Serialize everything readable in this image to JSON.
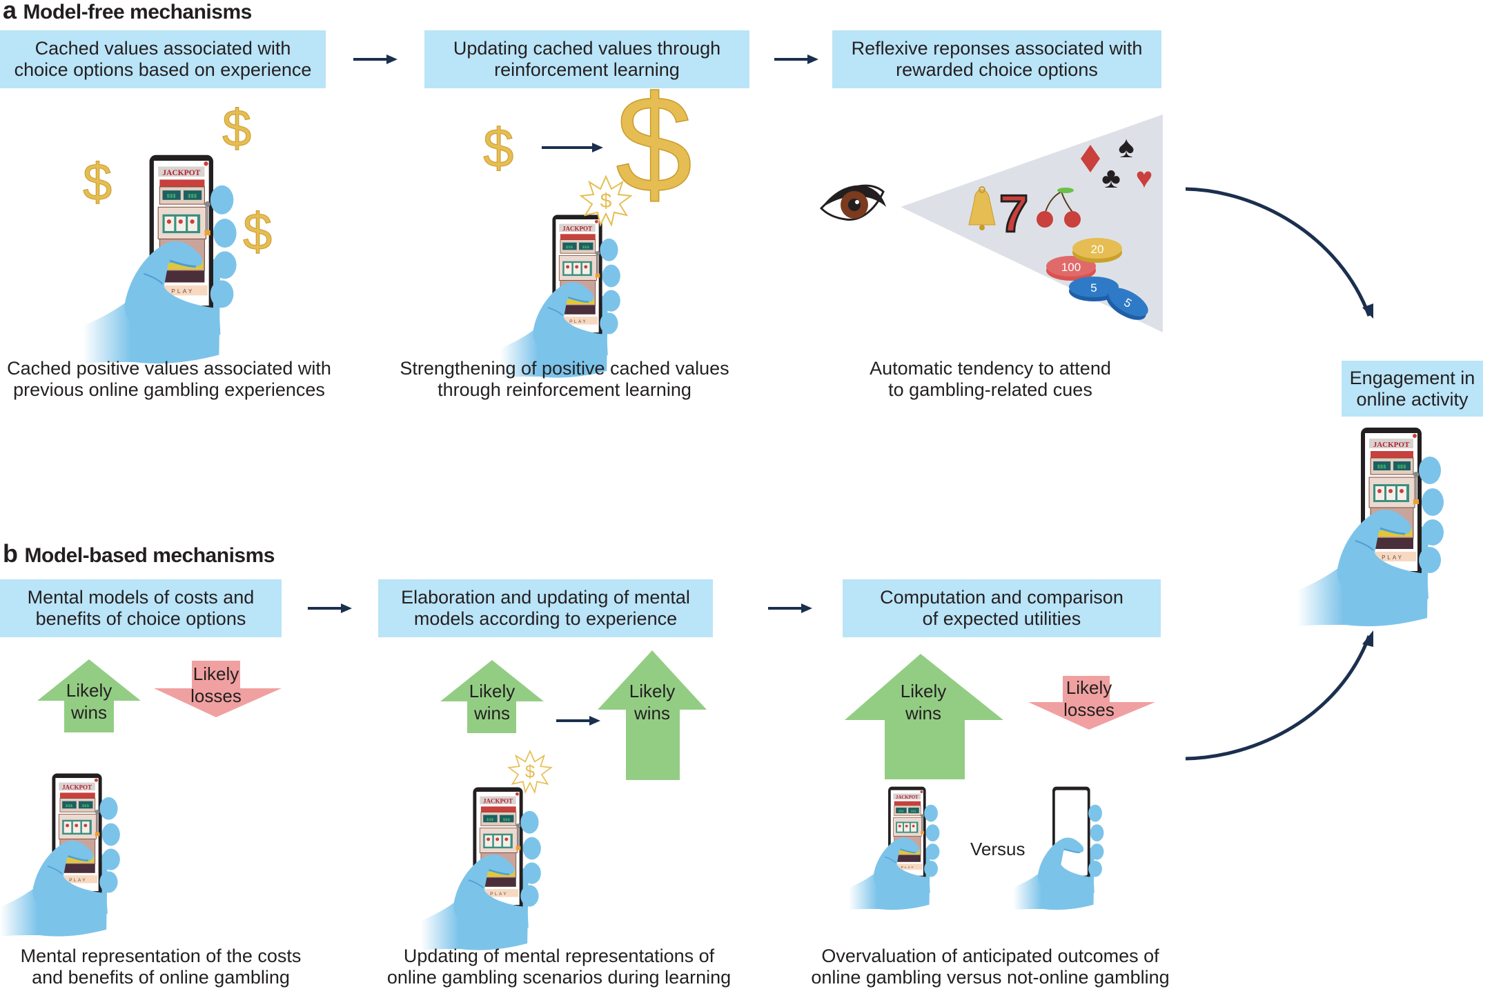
{
  "panel_a": {
    "letter": "a",
    "title": "Model-free mechanisms",
    "boxes": [
      {
        "line1": "Cached values associated with",
        "line2": "choice options based on experience"
      },
      {
        "line1": "Updating cached values through",
        "line2": "reinforcement learning"
      },
      {
        "line1": "Reflexive reponses associated with",
        "line2": "rewarded choice options"
      }
    ],
    "captions": [
      {
        "line1": "Cached positive values associated with",
        "line2": "previous online gambling experiences"
      },
      {
        "line1": "Strengthening of positive cached values",
        "line2": "through reinforcement learning"
      },
      {
        "line1": "Automatic tendency to attend",
        "line2": "to gambling-related cues"
      }
    ],
    "cue_icons": [
      "bell-icon",
      "seven-icon",
      "cherries-icon",
      "diamond-icon",
      "spade-icon",
      "club-icon",
      "heart-icon",
      "chip-100-icon",
      "chip-20-icon",
      "chip-5-icon",
      "chip-5-icon"
    ],
    "chip_labels": {
      "red": "100",
      "gold": "20",
      "blue1": "5",
      "blue2": "5"
    },
    "seven": "7",
    "dollar": "$"
  },
  "panel_b": {
    "letter": "b",
    "title": "Model-based mechanisms",
    "boxes": [
      {
        "line1": "Mental models of costs and",
        "line2": "benefits of choice options"
      },
      {
        "line1": "Elaboration and updating of mental",
        "line2": "models according to experience"
      },
      {
        "line1": "Computation and comparison",
        "line2": "of expected utilities"
      }
    ],
    "arrows": {
      "wins_line1": "Likely",
      "wins_line2": "wins",
      "losses_line1": "Likely",
      "losses_line2": "losses"
    },
    "versus": "Versus",
    "captions": [
      {
        "line1": "Mental representation of the costs",
        "line2": "and benefits of online gambling"
      },
      {
        "line1": "Updating of mental representations of",
        "line2": "online gambling scenarios during learning"
      },
      {
        "line1": "Overvaluation of anticipated outcomes of",
        "line2": "online gambling versus not-online gambling"
      }
    ]
  },
  "outcome": {
    "line1": "Engagement in",
    "line2": "online activity"
  },
  "phone": {
    "jackpot": "JACKPOT",
    "play": "P L A Y",
    "display": "$$$"
  },
  "colors": {
    "box_fill": "#bae4f7",
    "arrow_navy": "#1b2f4e",
    "wins_green": "#93cd84",
    "losses_pink": "#f0a0a0",
    "gold": "#e5bd52",
    "hand_blue": "#7cc3ea",
    "cone_gray": "#dde1e7"
  }
}
